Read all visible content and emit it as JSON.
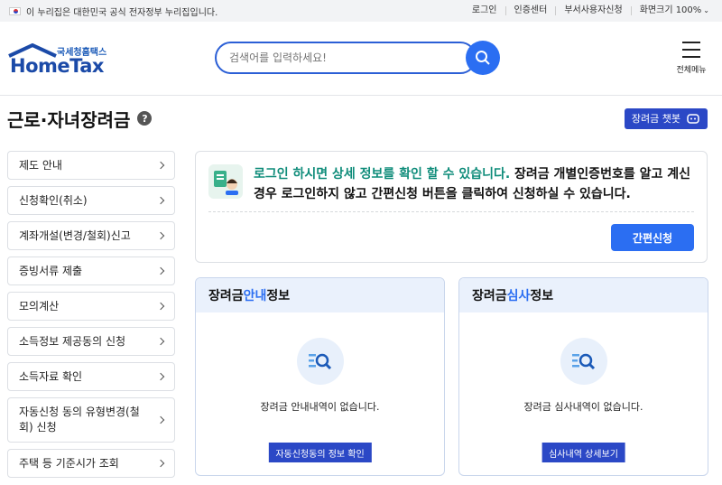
{
  "gov_bar": {
    "notice": "이 누리집은 대한민국 공식 전자정부 누리집입니다.",
    "links": [
      "로그인",
      "인증센터",
      "부서사용자신청",
      "화면크기 100%"
    ]
  },
  "header": {
    "logo_sub": "국세청홈택스",
    "logo_main": "HomeTax",
    "search_placeholder": "검색어를 입력하세요!",
    "menu_label": "전체메뉴"
  },
  "page": {
    "title": "근로·자녀장려금",
    "help": "?",
    "chatbot_label": "장려금 챗봇"
  },
  "sidebar": {
    "items": [
      "제도 안내",
      "신청확인(취소)",
      "계좌개설(변경/철회)신고",
      "증빙서류 제출",
      "모의계산",
      "소득정보 제공동의 신청",
      "소득자료 확인",
      "자동신청 동의 유형변경(철회) 신청",
      "주택 등 기준시가 조회"
    ]
  },
  "notice": {
    "highlight": "로그인 하시면 상세 정보를 확인 할 수 있습니다.",
    "rest": " 장려금 개별인증번호를 알고 계신 경우 로그인하지 않고 간편신청 버튼을 클릭하여 신청하실 수 있습니다.",
    "button": "간편신청"
  },
  "cards": [
    {
      "title_pre": "장려금 ",
      "title_hl": "안내",
      "title_post": " 정보",
      "empty": "장려금 안내내역이 없습니다.",
      "button": "자동신청동의 정보 확인"
    },
    {
      "title_pre": "장려금 ",
      "title_hl": "심사",
      "title_post": " 정보",
      "empty": "장려금 심사내역이 없습니다.",
      "button": "심사내역 상세보기"
    }
  ],
  "colors": {
    "primary": "#2b6ef2",
    "navy": "#2b48c6",
    "teal": "#0f8c7a"
  }
}
